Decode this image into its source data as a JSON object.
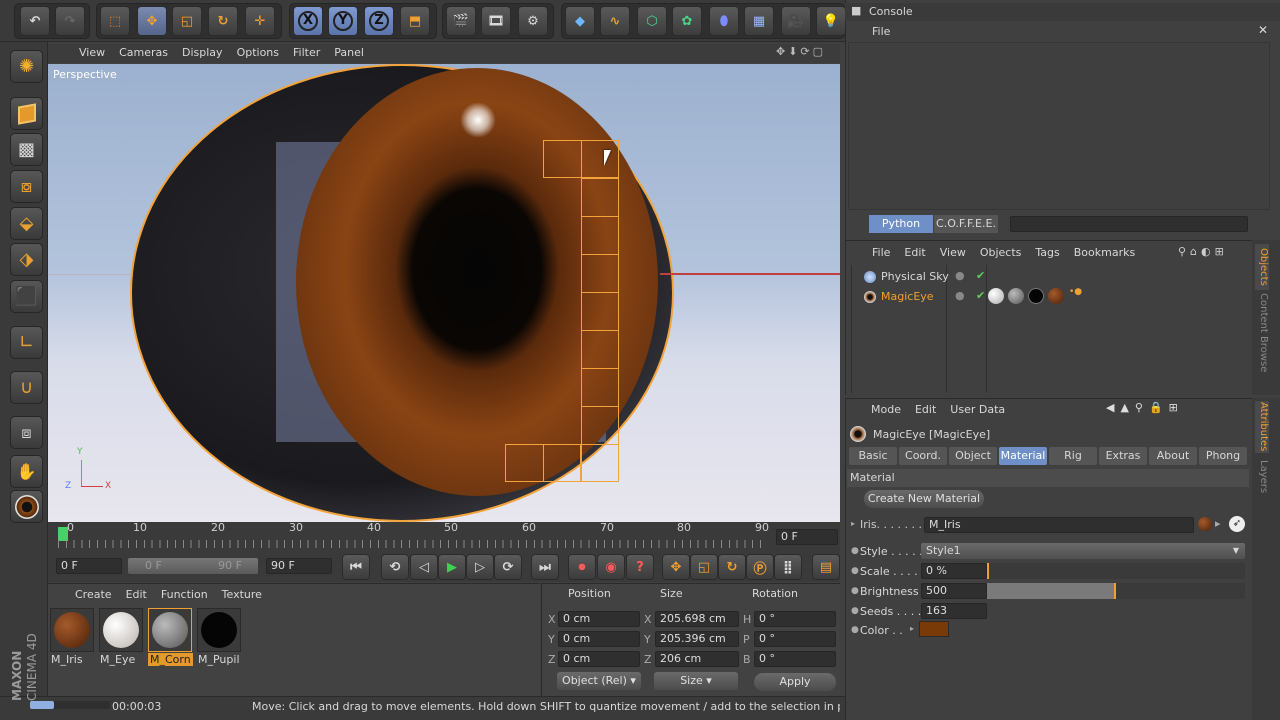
{
  "toolbar": {
    "undo": "undo",
    "x": "X",
    "y": "Y",
    "z": "Z"
  },
  "viewport": {
    "menu": [
      "View",
      "Cameras",
      "Display",
      "Options",
      "Filter",
      "Panel"
    ],
    "label": "Perspective",
    "axes": {
      "y": "Y",
      "z": "Z",
      "x": "X"
    }
  },
  "timeline": {
    "ticks": [
      "0",
      "10",
      "20",
      "30",
      "40",
      "50",
      "60",
      "70",
      "80",
      "90"
    ],
    "frame_field": "0 F",
    "start": "0 F",
    "range_start": "0 F",
    "range_end": "90 F",
    "end": "90 F"
  },
  "material_manager": {
    "menu": [
      "Create",
      "Edit",
      "Function",
      "Texture"
    ],
    "materials": [
      {
        "name": "M_Iris",
        "color": "#6a3210"
      },
      {
        "name": "M_Eye",
        "color": "#e8e4df"
      },
      {
        "name": "M_Corn",
        "color": "#8a8a8a"
      },
      {
        "name": "M_Pupil",
        "color": "#050505"
      }
    ]
  },
  "coords": {
    "headers": [
      "Position",
      "Size",
      "Rotation"
    ],
    "rows": [
      {
        "axis": "X",
        "pos": "0 cm",
        "size_axis": "X",
        "size": "205.698 cm",
        "rot_axis": "H",
        "rot": "0 °"
      },
      {
        "axis": "Y",
        "pos": "0 cm",
        "size_axis": "Y",
        "size": "205.396 cm",
        "rot_axis": "P",
        "rot": "0 °"
      },
      {
        "axis": "Z",
        "pos": "0 cm",
        "size_axis": "Z",
        "size": "206 cm",
        "rot_axis": "B",
        "rot": "0 °"
      }
    ],
    "mode_select": "Object (Rel)",
    "size_select": "Size",
    "apply": "Apply"
  },
  "status": {
    "time": "00:00:03",
    "message": "Move: Click and drag to move elements. Hold down SHIFT to quantize movement / add to the selection in point mc",
    "brand1": "MAXON",
    "brand2": "CINEMA 4D"
  },
  "console": {
    "title": "Console",
    "menu": "File",
    "tabs": [
      "Python",
      "C.O.F.F.E.E."
    ]
  },
  "objects": {
    "menu": [
      "File",
      "Edit",
      "View",
      "Objects",
      "Tags",
      "Bookmarks"
    ],
    "items": [
      {
        "name": "Physical Sky"
      },
      {
        "name": "MagicEye"
      }
    ],
    "side_tabs": [
      "Objects",
      "Content Browse"
    ]
  },
  "attributes": {
    "menu": [
      "Mode",
      "Edit",
      "User Data"
    ],
    "object_title": "MagicEye [MagicEye]",
    "tabs": [
      "Basic",
      "Coord.",
      "Object",
      "Material",
      "Rig",
      "Extras",
      "About",
      "Phong"
    ],
    "section": "Material",
    "create_btn": "Create New Material",
    "iris_label": "Iris. . . . . . .",
    "iris_value": "M_Iris",
    "style_label": "Style . . . . .",
    "style_value": "Style1",
    "scale_label": "Scale . . . . .",
    "scale_value": "0 %",
    "scale_fraction": 0.0,
    "brightness_label": "Brightness",
    "brightness_value": "500",
    "brightness_fraction": 0.5,
    "seeds_label": "Seeds . . . .",
    "seeds_value": "163",
    "color_label": "Color . .",
    "color_value": "#7a3a08",
    "side_tabs": [
      "Attributes",
      "Layers"
    ]
  }
}
